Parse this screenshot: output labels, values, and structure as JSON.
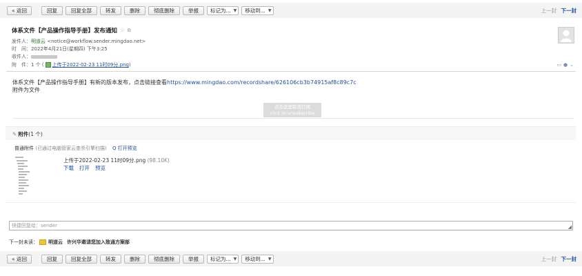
{
  "toolbar": {
    "back": "« 返回",
    "reply": "回复",
    "reply_all": "回复全部",
    "forward": "转发",
    "delete": "删除",
    "delete_permanently": "彻底删除",
    "report": "举报",
    "mark_as": "标记为...",
    "move_to": "移动到...",
    "prev": "上一封",
    "next": "下一封"
  },
  "mail": {
    "subject": "体系文件【产品操作指导手册】发布通知",
    "from_label": "发件人：",
    "sender_name": "明道云",
    "sender_email": "<notice@workflow.sender.mingdao.net>",
    "time_label": "时　间：",
    "time": "2022年4月21日(星期四) 下午3:25",
    "to_label": "收件人：",
    "attach_label": "附　件：",
    "attach_count": "1 个 (",
    "attach_file": "上传于2022-02-23 11时09分.png",
    "attach_close": ")",
    "body_text": "体系文件【产品操作指导手册】有新的版本发布，点击链接查看",
    "body_url": "https://www.mingdao.com/recordshare/626106cb3b74915af8c89c7c",
    "body_line2": "附件为文件",
    "unsub_cn": "点击这里取消订阅",
    "unsub_en": "click to unsubscribe"
  },
  "attachments": {
    "title_prefix": "附件",
    "title_count": "(1 个)",
    "normal_label": "普通附件",
    "scan_note": "(已通过电脑管家云查杀引擎扫描)",
    "preview_all": "Q 打开预览",
    "file_name": "上传于2022-02-23 11时09分.png",
    "file_size": "(98.10K)",
    "download": "下载",
    "open": "打开",
    "preview": "预览"
  },
  "reply": {
    "placeholder": "快捷回复给：sender"
  },
  "next_mail": {
    "label": "下一封未读：",
    "sender": "明道云",
    "subject": "许兴华邀请您加入致通方案部"
  },
  "colors": {
    "link": "#1f4e99",
    "sender": "#2d7d2d",
    "toolbar_bg": "#f4f4f4"
  }
}
